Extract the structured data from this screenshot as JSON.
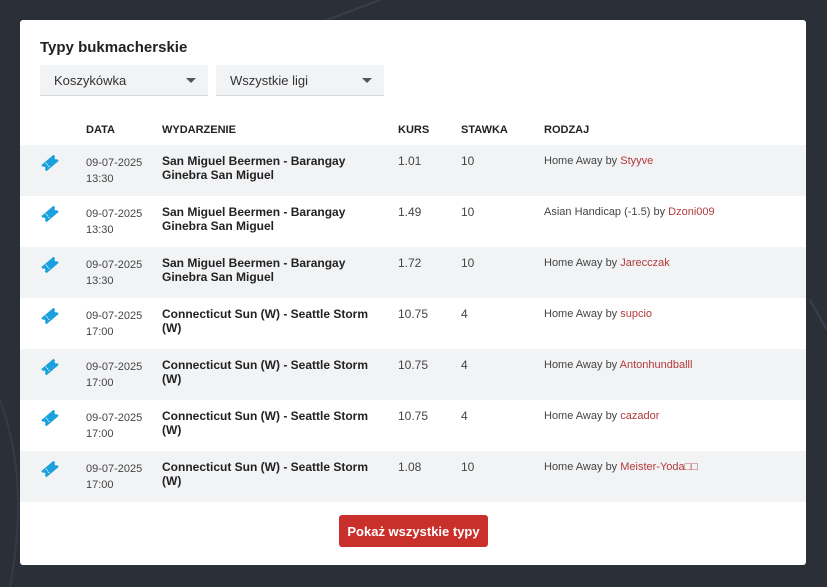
{
  "widget": {
    "title": "Typy bukmacherskie",
    "sport_select": "Koszykówka",
    "league_select": "Wszystkie ligi",
    "show_all_label": "Pokaż wszystkie typy"
  },
  "table": {
    "headers": {
      "date": "DATA",
      "event": "WYDARZENIE",
      "odds": "KURS",
      "stake": "STAWKA",
      "type": "RODZAJ"
    },
    "by_word": "by",
    "rows": [
      {
        "date": "09-07-2025",
        "time": "13:30",
        "event": "San Miguel Beermen - Barangay Ginebra San Miguel",
        "odds": "1.01",
        "stake": "10",
        "type": "Home Away",
        "user": "Styyve"
      },
      {
        "date": "09-07-2025",
        "time": "13:30",
        "event": "San Miguel Beermen - Barangay Ginebra San Miguel",
        "odds": "1.49",
        "stake": "10",
        "type": "Asian Handicap (-1.5)",
        "user": "Dzoni009"
      },
      {
        "date": "09-07-2025",
        "time": "13:30",
        "event": "San Miguel Beermen - Barangay Ginebra San Miguel",
        "odds": "1.72",
        "stake": "10",
        "type": "Home Away",
        "user": "Jarecczak"
      },
      {
        "date": "09-07-2025",
        "time": "17:00",
        "event": "Connecticut Sun (W) - Seattle Storm (W)",
        "odds": "10.75",
        "stake": "4",
        "type": "Home Away",
        "user": "supcio"
      },
      {
        "date": "09-07-2025",
        "time": "17:00",
        "event": "Connecticut Sun (W) - Seattle Storm (W)",
        "odds": "10.75",
        "stake": "4",
        "type": "Home Away",
        "user": "Antonhundballl"
      },
      {
        "date": "09-07-2025",
        "time": "17:00",
        "event": "Connecticut Sun (W) - Seattle Storm (W)",
        "odds": "10.75",
        "stake": "4",
        "type": "Home Away",
        "user": "cazador"
      },
      {
        "date": "09-07-2025",
        "time": "17:00",
        "event": "Connecticut Sun (W) - Seattle Storm (W)",
        "odds": "1.08",
        "stake": "10",
        "type": "Home Away",
        "user": "Meister-Yoda□□"
      }
    ]
  },
  "icons": {
    "row_icon": "ticket-icon",
    "select_caret": "caret-down-icon"
  },
  "colors": {
    "accent_button": "#c9302c",
    "user_link": "#b23a3a",
    "ticket_icon": "#1aa0dc"
  }
}
